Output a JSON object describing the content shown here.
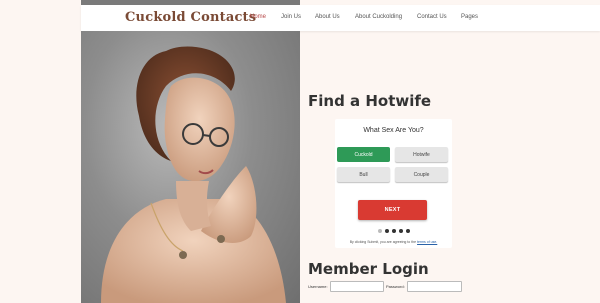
{
  "nav": {
    "logo": "Cuckold Contacts",
    "items": [
      {
        "label": "Home",
        "active": true
      },
      {
        "label": "Join Us",
        "active": false
      },
      {
        "label": "About Us",
        "active": false
      },
      {
        "label": "About Cuckolding",
        "active": false
      },
      {
        "label": "Contact Us",
        "active": false
      },
      {
        "label": "Pages",
        "active": false
      }
    ]
  },
  "find_section": {
    "heading": "Find a Hotwife",
    "question": "What Sex Are You?",
    "options": [
      {
        "label": "Cuckold",
        "selected": true
      },
      {
        "label": "Hotwife",
        "selected": false
      },
      {
        "label": "Bull",
        "selected": false
      },
      {
        "label": "Couple",
        "selected": false
      }
    ],
    "next_label": "NEXT",
    "steps_total": 5,
    "step_current": 1,
    "terms_prefix": "By clicking Submit, you are agreeing to the ",
    "terms_link": "terms of use."
  },
  "login": {
    "heading": "Member Login",
    "username_label": "Username:",
    "password_label": "Password:"
  },
  "colors": {
    "accent_green": "#2e9a57",
    "accent_red": "#d93a32",
    "logo_brown": "#7a4a35",
    "nav_active": "#b74a4a",
    "page_bg": "#fdf6f2"
  }
}
